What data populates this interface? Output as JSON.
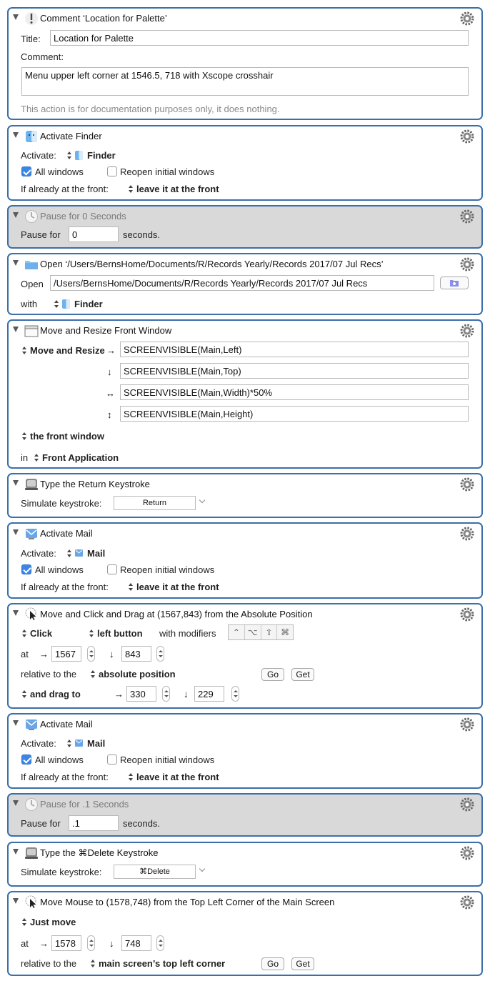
{
  "actions": {
    "comment": {
      "title": "Comment ‘Location for Palette’",
      "title_label": "Title:",
      "title_value": "Location for Palette",
      "comment_label": "Comment:",
      "comment_value": "Menu upper left corner at 1546.5, 718 with Xscope crosshair",
      "note": "This action is for documentation purposes only, it does nothing."
    },
    "activate_finder": {
      "title": "Activate Finder",
      "activate_label": "Activate:",
      "app": "Finder",
      "all_windows": "All windows",
      "all_windows_checked": true,
      "reopen": "Reopen initial windows",
      "reopen_checked": false,
      "front_label": "If already at the front:",
      "front_value": "leave it at the front"
    },
    "pause1": {
      "title": "Pause for 0 Seconds",
      "label": "Pause for",
      "value": "0",
      "unit": "seconds."
    },
    "open": {
      "title": "Open ‘/Users/BernsHome/Documents/R/Records Yearly/Records 2017/07 Jul Recs’",
      "open_label": "Open",
      "path": "/Users/BernsHome/Documents/R/Records Yearly/Records 2017/07 Jul Recs",
      "with_label": "with",
      "app": "Finder"
    },
    "move_resize": {
      "title": "Move and Resize Front Window",
      "mode": "Move and Resize",
      "arrow_left": "→",
      "arrow_top": "↓",
      "arrow_width": "↔",
      "arrow_height": "↕",
      "left": "SCREENVISIBLE(Main,Left)",
      "top": "SCREENVISIBLE(Main,Top)",
      "width": "SCREENVISIBLE(Main,Width)*50%",
      "height": "SCREENVISIBLE(Main,Height)",
      "target": "the front window",
      "in_label": "in",
      "in_value": "Front Application"
    },
    "return_key": {
      "title": "Type the Return Keystroke",
      "label": "Simulate keystroke:",
      "key": "Return"
    },
    "activate_mail1": {
      "title": "Activate Mail",
      "activate_label": "Activate:",
      "app": "Mail",
      "all_windows": "All windows",
      "reopen": "Reopen initial windows",
      "front_label": "If already at the front:",
      "front_value": "leave it at the front"
    },
    "click_drag": {
      "title": "Move and Click and Drag at (1567,843) from the Absolute Position",
      "click": "Click",
      "button": "left button",
      "modifiers_label": "with modifiers",
      "modifiers": [
        "⌃",
        "⌥",
        "⇧",
        "⌘"
      ],
      "at_label": "at",
      "x_arrow": "→",
      "x": "1567",
      "y_arrow": "↓",
      "y": "843",
      "relative_label": "relative to the",
      "relative_value": "absolute position",
      "go": "Go",
      "get": "Get",
      "drag_label": "and drag to",
      "drag_x": "330",
      "drag_y": "229"
    },
    "activate_mail2": {
      "title": "Activate Mail",
      "activate_label": "Activate:",
      "app": "Mail",
      "all_windows": "All windows",
      "reopen": "Reopen initial windows",
      "front_label": "If already at the front:",
      "front_value": "leave it at the front"
    },
    "pause2": {
      "title": "Pause for .1 Seconds",
      "label": "Pause for",
      "value": ".1",
      "unit": "seconds."
    },
    "delete_key": {
      "title": "Type the ⌘Delete Keystroke",
      "label": "Simulate keystroke:",
      "key": "⌘Delete"
    },
    "move_mouse": {
      "title": "Move Mouse to (1578,748) from the Top Left Corner of the Main Screen",
      "mode": "Just move",
      "at_label": "at",
      "x_arrow": "→",
      "x": "1578",
      "y_arrow": "↓",
      "y": "748",
      "relative_label": "relative to the",
      "relative_value": "main screen’s top left corner",
      "go": "Go",
      "get": "Get"
    }
  },
  "colors": {
    "action_border": "#3a6fa8",
    "disabled_bg": "#d9d9d9",
    "checkbox_on": "#3b86e5"
  },
  "icons": [
    "disclosure-triangle-icon",
    "gear-icon",
    "comment-icon",
    "finder-icon",
    "clock-icon",
    "folder-icon",
    "window-icon",
    "keyboard-icon",
    "mail-icon",
    "mouse-click-icon"
  ]
}
